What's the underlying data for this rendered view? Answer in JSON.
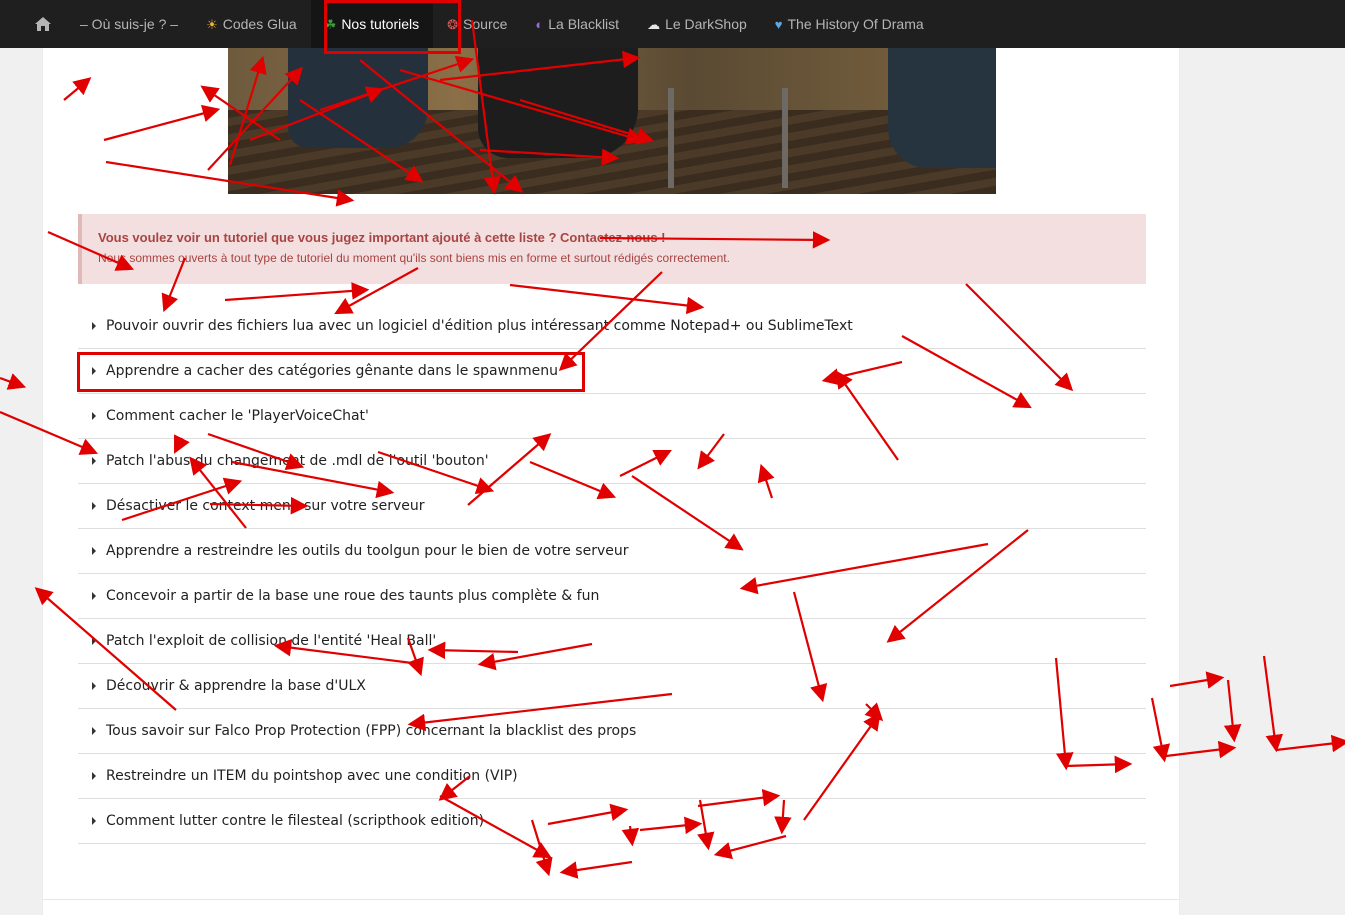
{
  "nav": {
    "items": [
      {
        "label": "– Où suis-je ? –",
        "icon": ""
      },
      {
        "label": "Codes Glua",
        "icon": "☀"
      },
      {
        "label": "Nos tutoriels",
        "icon": "☘"
      },
      {
        "label": "Source",
        "icon": "❂"
      },
      {
        "label": "La Blacklist",
        "icon": "◐"
      },
      {
        "label": "Le DarkShop",
        "icon": "☁"
      },
      {
        "label": "The History Of Drama",
        "icon": "♥"
      }
    ],
    "active_index": 2
  },
  "alert": {
    "title": "Vous voulez voir un tutoriel que vous jugez important ajouté à cette liste ? Contactez-nous !",
    "text": "Nous sommes ouverts à tout type de tutoriel du moment qu'ils sont biens mis en forme et surtout rédigés correctement."
  },
  "tutorials": [
    "Pouvoir ouvrir des fichiers lua avec un logiciel d'édition plus intéressant comme Notepad+ ou SublimeText",
    "Apprendre a cacher des catégories gênante dans le spawnmenu",
    "Comment cacher le 'PlayerVoiceChat'",
    "Patch l'abus du changement de .mdl de l'outil 'bouton'",
    "Désactiver le context menu sur votre serveur",
    "Apprendre a restreindre les outils du toolgun pour le bien de votre serveur",
    "Concevoir a partir de la base une roue des taunts plus complète & fun",
    "Patch l'exploit de collision de l'entité 'Heal Ball'",
    "Découvrir & apprendre la base d'ULX",
    "Tous savoir sur Falco Prop Protection (FPP) concernant la blacklist des props",
    "Restreindre un ITEM du pointshop avec une condition (VIP)",
    "Comment lutter contre le filesteal (scripthook edition)"
  ],
  "colors": {
    "navbar": "#1f1f1f",
    "alert_bg": "#f3dfdf",
    "alert_text": "#a94442",
    "annotation": "#e00000"
  }
}
